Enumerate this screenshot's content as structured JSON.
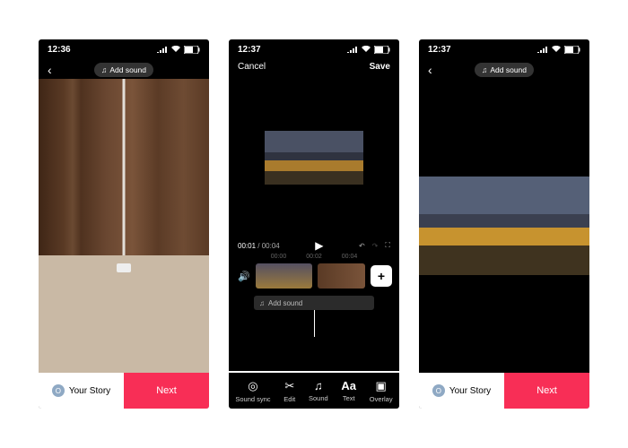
{
  "status": {
    "time1": "12:36",
    "time2": "12:37",
    "time3": "12:37",
    "battery": "63"
  },
  "add_sound_label": "Add sound",
  "right_tools": [
    "flip",
    "text",
    "filters",
    "beautify",
    "sticker",
    "voice"
  ],
  "bottom": {
    "your_story": "Your Story",
    "next": "Next",
    "avatar_initial": "O"
  },
  "editor": {
    "cancel": "Cancel",
    "save": "Save",
    "time_current": "00:01",
    "time_total": "/ 00:04",
    "ticks": [
      "00:00",
      "00:02",
      "00:04"
    ],
    "tabs": [
      {
        "icon": "sync",
        "label": "Sound sync"
      },
      {
        "icon": "cut",
        "label": "Edit"
      },
      {
        "icon": "note",
        "label": "Sound"
      },
      {
        "icon": "text",
        "label": "Text"
      },
      {
        "icon": "overlay",
        "label": "Overlay"
      }
    ]
  }
}
